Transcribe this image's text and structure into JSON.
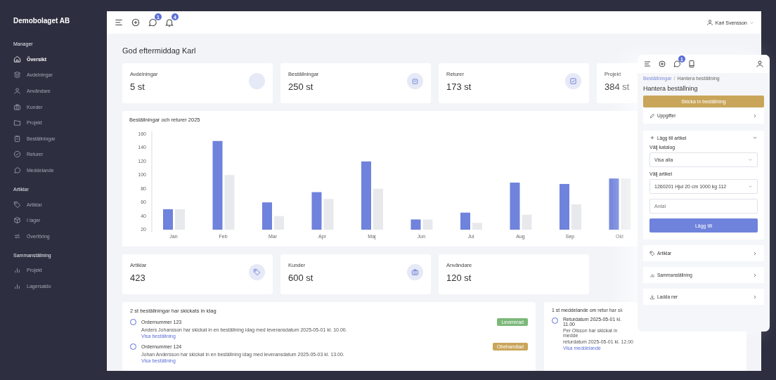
{
  "sidebar": {
    "brand": "Demobolaget AB",
    "sections": [
      {
        "title": "Manager",
        "items": [
          {
            "label": "Översikt",
            "selected": true
          },
          {
            "label": "Avdelningar",
            "selected": false
          },
          {
            "label": "Användare",
            "selected": false
          },
          {
            "label": "Kunder",
            "selected": false
          },
          {
            "label": "Projekt",
            "selected": false
          },
          {
            "label": "Beställningar",
            "selected": false
          },
          {
            "label": "Returer",
            "selected": false
          },
          {
            "label": "Meddelande",
            "selected": false
          }
        ]
      },
      {
        "title": "Artiklar",
        "items": [
          {
            "label": "Artiklar",
            "selected": false
          },
          {
            "label": "I lager",
            "selected": false
          },
          {
            "label": "Överföring",
            "selected": false
          }
        ]
      },
      {
        "title": "Sammanställning",
        "items": [
          {
            "label": "Projekt",
            "selected": false
          },
          {
            "label": "Lagersaldo",
            "selected": false
          }
        ]
      }
    ]
  },
  "topbar": {
    "message_badge": "1",
    "notification_badge": "4",
    "user": "Karl Svensson"
  },
  "greeting": "God eftermiddag Karl",
  "stats": [
    {
      "label": "Avdelningar",
      "value": "5 st"
    },
    {
      "label": "Beställningar",
      "value": "250 st"
    },
    {
      "label": "Returer",
      "value": "173 st"
    },
    {
      "label": "Projekt",
      "value": "384 st"
    }
  ],
  "chart": {
    "chart_data": {
      "type": "bar",
      "title": "Beställningar och returer 2025",
      "categories": [
        "Jan",
        "Feb",
        "Mar",
        "Apr",
        "Maj",
        "Jun",
        "Jul",
        "Aug",
        "Sep",
        "Okt"
      ],
      "ylim": [
        20,
        160
      ],
      "yticks": [
        20,
        40,
        60,
        80,
        100,
        120,
        140,
        160
      ],
      "series": [
        {
          "color": "#6f82dc",
          "values": [
            50,
            150,
            60,
            75,
            120,
            35,
            45,
            89,
            87,
            95
          ]
        },
        {
          "color": "#e8e9ec",
          "values": [
            50,
            100,
            40,
            65,
            80,
            35,
            30,
            42,
            57,
            95
          ]
        }
      ]
    }
  },
  "stats_2": [
    {
      "label": "Artiklar",
      "value": "423"
    },
    {
      "label": "Kunder",
      "value": "600 st"
    },
    {
      "label": "Användare",
      "value": "120 st"
    }
  ],
  "orders": {
    "title": "2 st beställningar har skickats in idag",
    "items": [
      {
        "title": "Ordernummer 123",
        "text": "Anders Johansson har skickat in en beställning idag med leveransdatum 2025-05-01 kl. 10.00.",
        "link": "Visa beställning",
        "status": "Levererad",
        "color": "#7cb87a"
      },
      {
        "title": "Ordernummer 124",
        "text": "Johan Andersson har skickat in en beställning idag med leveransdatum 2025-05-03 kl. 13.00.",
        "link": "Visa beställning",
        "status": "Obehandlad",
        "color": "#c9a55a"
      }
    ]
  },
  "returns": {
    "title": "1 st meddelande om retur har sk",
    "items": [
      {
        "title": "Returdatum 2025-05-01 kl. 11.00",
        "text": "Per Olsson har skickat in medde",
        "text_2": "returdatum 2025-05-01 kl. 12.00",
        "link": "Visa meddelande"
      }
    ]
  },
  "mobile": {
    "chat_badge": "1",
    "breadcrumb": [
      "Beställningar",
      "Hantera beställning"
    ],
    "breadcrumb_separator": "/",
    "title": "Hantera beställning",
    "submit": "Skicka in beställning",
    "sections": [
      {
        "kind": "collapsed",
        "label": "Uppgifter"
      },
      {
        "kind": "form",
        "label": "Lägg till artikel",
        "expanded": true,
        "catalog_label": "Välj katalog",
        "catalog_value": "Visa alla",
        "article_label": "Välj artikel",
        "article_value": "1260201 Hjul 20 cm 1000 kg 112",
        "quantity_placeholder": "Antal",
        "button": "Lägg till"
      },
      {
        "kind": "collapsed",
        "label": "Artiklar"
      },
      {
        "kind": "collapsed",
        "label": "Sammanställning"
      },
      {
        "kind": "collapsed",
        "label": "Ladda ner"
      }
    ]
  }
}
